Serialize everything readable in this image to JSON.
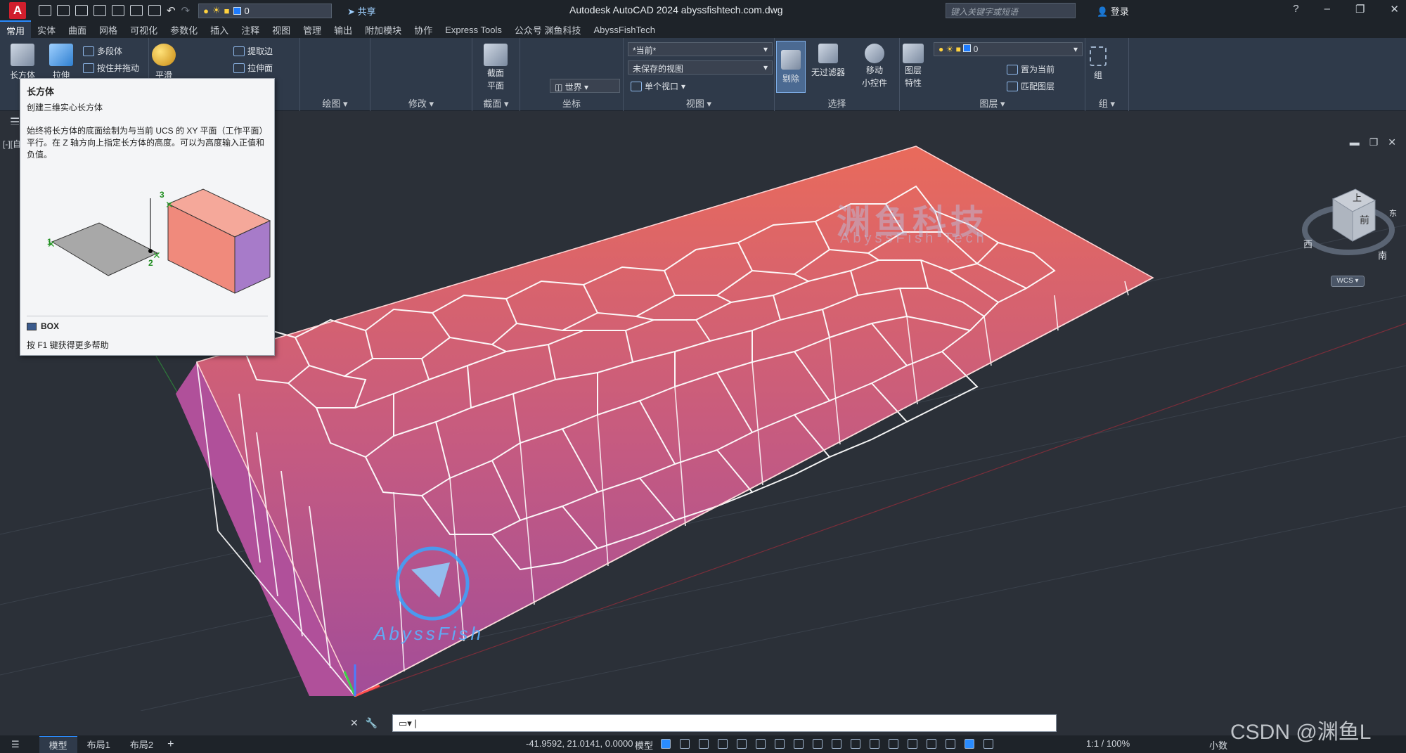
{
  "app": {
    "logo": "A",
    "title": "Autodesk AutoCAD 2024    abyssfishtech.com.dwg",
    "layer_value": "0",
    "share": "共享",
    "search_placeholder": "键入关键字或短语",
    "login": "登录"
  },
  "tabs": [
    "常用",
    "实体",
    "曲面",
    "网格",
    "可视化",
    "参数化",
    "插入",
    "注释",
    "视图",
    "管理",
    "输出",
    "附加模块",
    "协作",
    "Express Tools",
    "公众号 渊鱼科技",
    "AbyssFishTech"
  ],
  "ribbon": {
    "box_label": "长方体",
    "extrude_label": "拉伸",
    "polysolid": "多段体",
    "presspull": "按住并拖动",
    "smooth": "平滑",
    "extract_edges": "提取边",
    "extrude_face": "拉伸面",
    "panel_draw": "绘图",
    "panel_modify": "修改",
    "panel_section": "截面",
    "section_plane": "截面",
    "section_plane2": "平面",
    "panel_coords": "坐标",
    "world": "世界",
    "view_current": "*当前*",
    "unsaved_view": "未保存的视图",
    "single_viewport": "单个视口",
    "panel_view": "视图",
    "culling": "剔除",
    "no_filter": "无过滤器",
    "move_gizmo": "移动",
    "move_gizmo2": "小控件",
    "panel_select": "选择",
    "layer_props": "图层",
    "layer_props2": "特性",
    "set_current": "置为当前",
    "match_layer": "匹配图层",
    "panel_layers": "图层",
    "group": "组",
    "panel_group": "组",
    "layer_dd": "0"
  },
  "tooltip": {
    "title": "长方体",
    "subtitle": "创建三维实心长方体",
    "description": "始终将长方体的底面绘制为与当前 UCS 的 XY 平面（工作平面）平行。在 Z 轴方向上指定长方体的高度。可以为高度输入正值和负值。",
    "fig_labels": [
      "1",
      "2",
      "3"
    ],
    "command": "BOX",
    "help": "按 F1 键获得更多帮助"
  },
  "viewport": {
    "label": "[-][自定义视图][真实]",
    "watermark_cn": "渊鱼科技",
    "watermark_en": "AbyssFish Tech",
    "logo_text": "AbyssFish"
  },
  "viewcube": {
    "top": "上",
    "front": "前",
    "west": "西",
    "south": "南",
    "east": "东",
    "wcs": "WCS"
  },
  "statusbar": {
    "layouts": [
      "模型",
      "布局1",
      "布局2"
    ],
    "coords": "-41.9592, 21.0141, 0.0000",
    "model": "模型",
    "scale": "1:1 / 100%",
    "units": "小数"
  },
  "watermark": "CSDN @渊鱼L",
  "colors": {
    "accent": "#2a8cff",
    "box_fill": "#e8665a",
    "box_side": "#b0509a",
    "cell_edge": "#ffffff"
  }
}
